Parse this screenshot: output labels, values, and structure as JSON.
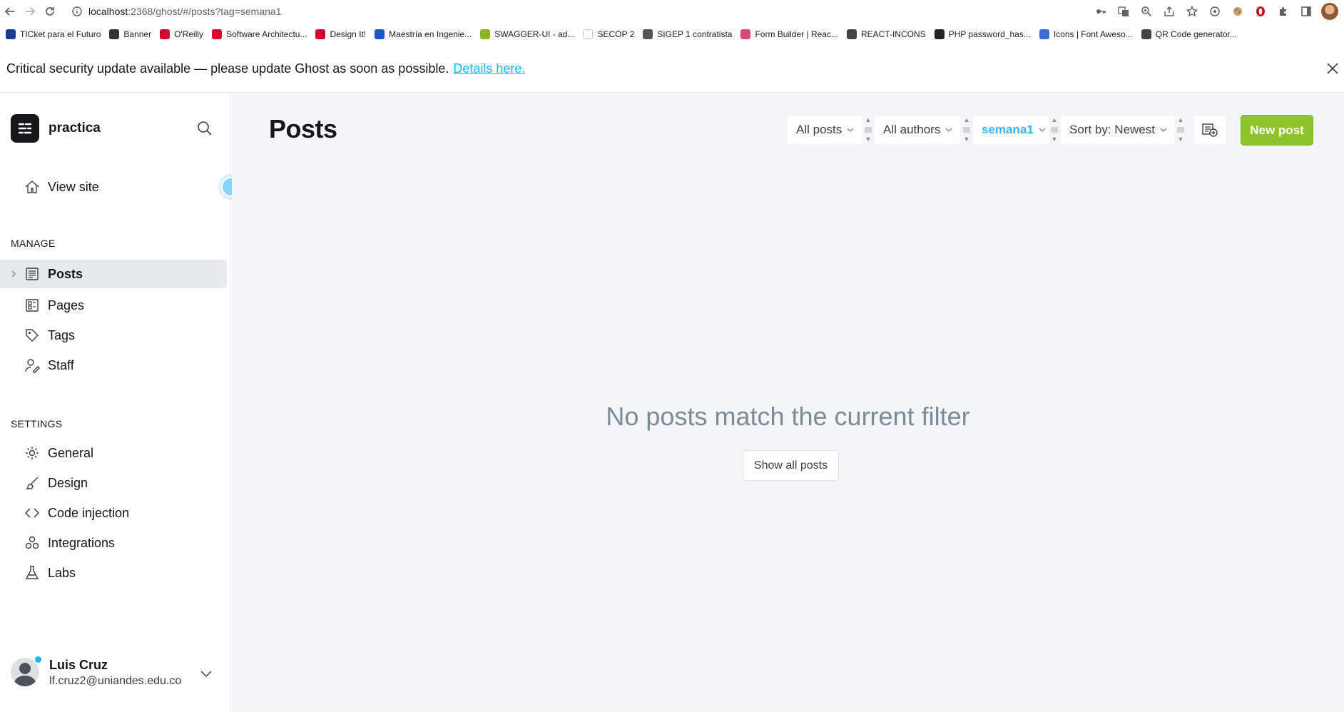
{
  "browser": {
    "url_host": "localhost",
    "url_rest": ":2368/ghost/#/posts?tag=semana1",
    "bookmarks": [
      {
        "label": "TICket para el Futuro",
        "color": "#1a3d8f"
      },
      {
        "label": "Banner",
        "color": "#333333"
      },
      {
        "label": "O'Reilly",
        "color": "#d3002d"
      },
      {
        "label": "Software Architectu...",
        "color": "#d3002d"
      },
      {
        "label": "Design It!",
        "color": "#d3002d"
      },
      {
        "label": "Maestría en Ingenie...",
        "color": "#1a57c9"
      },
      {
        "label": "SWAGGER-UI - ad...",
        "color": "#85b818"
      },
      {
        "label": "SECOP 2",
        "color": "#ffffff"
      },
      {
        "label": "SIGEP 1 contratista",
        "color": "#555555"
      },
      {
        "label": "Form Builder | Reac...",
        "color": "#e0457b"
      },
      {
        "label": "REACT-INCONS",
        "color": "#444444"
      },
      {
        "label": "PHP password_has...",
        "color": "#222222"
      },
      {
        "label": "Icons | Font Aweso...",
        "color": "#3a6fd8"
      },
      {
        "label": "QR Code generator...",
        "color": "#444444"
      }
    ]
  },
  "banner": {
    "text": "Critical security update available — please update Ghost as soon as possible.",
    "link": "Details here."
  },
  "sidebar": {
    "site_name": "practica",
    "view_site": "View site",
    "manage_title": "MANAGE",
    "settings_title": "SETTINGS",
    "manage_items": [
      {
        "label": "Posts"
      },
      {
        "label": "Pages"
      },
      {
        "label": "Tags"
      },
      {
        "label": "Staff"
      }
    ],
    "settings_items": [
      {
        "label": "General"
      },
      {
        "label": "Design"
      },
      {
        "label": "Code injection"
      },
      {
        "label": "Integrations"
      },
      {
        "label": "Labs"
      }
    ],
    "user": {
      "name": "Luis Cruz",
      "email": "lf.cruz2@uniandes.edu.co"
    }
  },
  "main": {
    "title": "Posts",
    "filters": {
      "type": "All posts",
      "author": "All authors",
      "tag": "semana1",
      "sort": "Sort by: Newest"
    },
    "new_post": "New post",
    "empty_message": "No posts match the current filter",
    "show_all": "Show all posts"
  },
  "colors": {
    "accent_green": "#8ec42e",
    "link_blue": "#14b8ff",
    "tag_blue": "#3eb0ef"
  }
}
